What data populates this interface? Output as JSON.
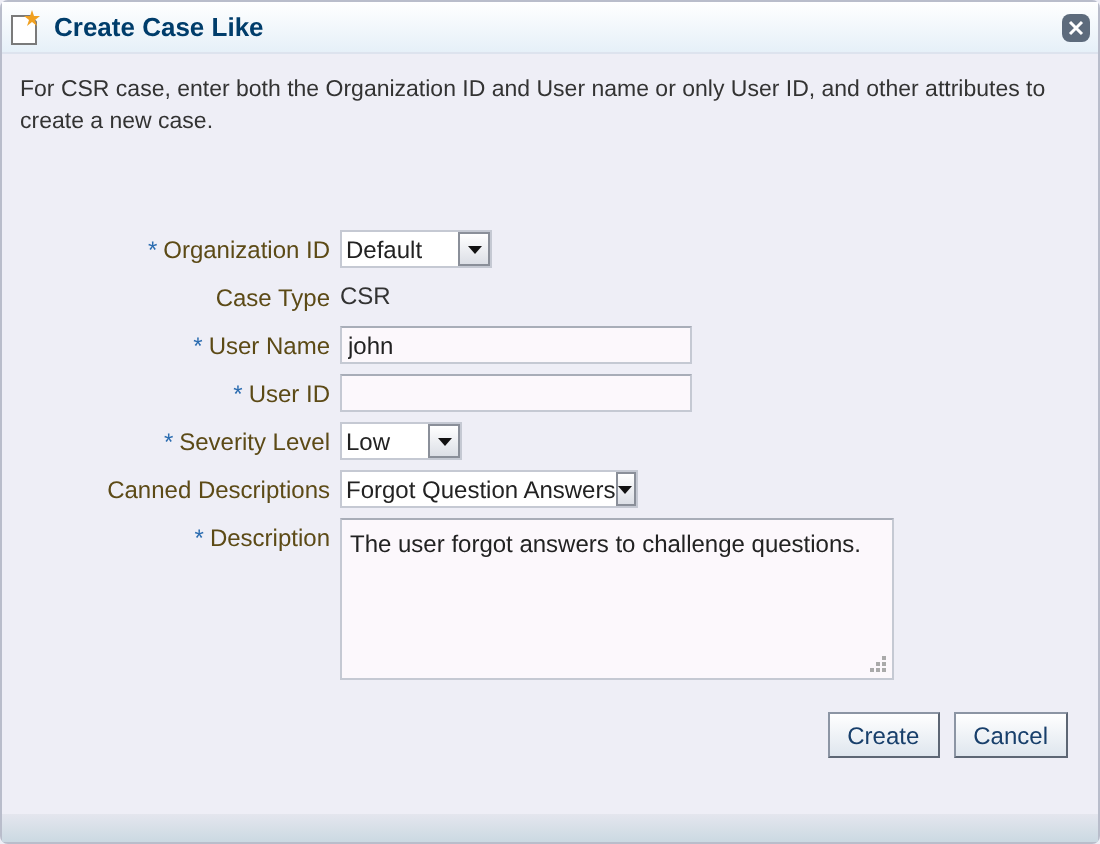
{
  "window": {
    "title": "Create Case Like"
  },
  "instructions": "For CSR case, enter both the Organization ID and User name or only User ID, and other attributes to create a new case.",
  "fields": [
    {
      "kind": "select",
      "marker": "*",
      "label": "Organization ID",
      "value": "Default"
    },
    {
      "kind": "static",
      "label": "Case Type",
      "value": "CSR"
    },
    {
      "kind": "text",
      "marker": "*",
      "label": "User Name",
      "value": "john"
    },
    {
      "kind": "text",
      "marker": "*",
      "label": "User ID"
    },
    {
      "kind": "select",
      "marker": "*",
      "label": "Severity Level",
      "value": "Low"
    },
    {
      "kind": "select",
      "label": "Canned Descriptions",
      "value": "Forgot Question Answers"
    },
    {
      "kind": "textarea",
      "marker": "*",
      "label": "Description",
      "value": "The user forgot answers to challenge questions."
    }
  ],
  "buttons": [
    "Create",
    "Cancel"
  ]
}
